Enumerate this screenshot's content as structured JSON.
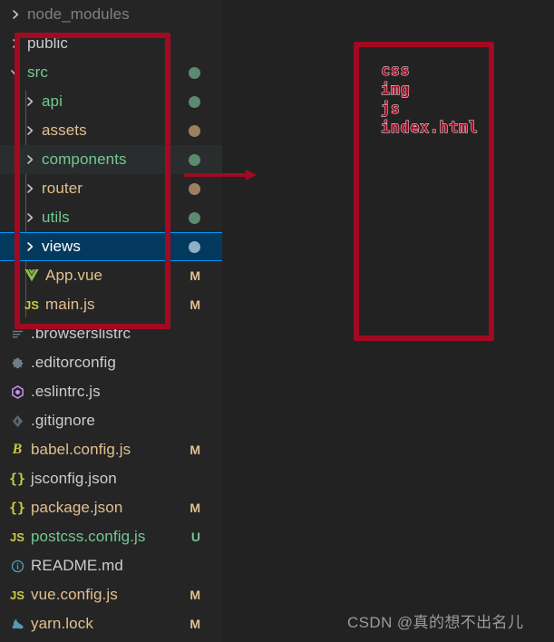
{
  "window": {
    "background": "#222222",
    "panel_background": "#252526"
  },
  "explorer": {
    "name": "vscode-file-explorer",
    "rows": [
      {
        "label": "node_modules",
        "kind": "folder",
        "expanded": false,
        "indent": 0,
        "color": "#808080",
        "badge": "",
        "dot": "",
        "state": "normal"
      },
      {
        "label": "public",
        "kind": "folder",
        "expanded": false,
        "indent": 0,
        "color": "#CCCCCC",
        "badge": "",
        "dot": "",
        "state": "normal"
      },
      {
        "label": "src",
        "kind": "folder",
        "expanded": true,
        "indent": 0,
        "color": "#73C991",
        "badge": "",
        "dot": "#5B8A6E",
        "state": "normal"
      },
      {
        "label": "api",
        "kind": "folder",
        "expanded": false,
        "indent": 1,
        "color": "#73C991",
        "badge": "",
        "dot": "#5B8A6E",
        "state": "normal"
      },
      {
        "label": "assets",
        "kind": "folder",
        "expanded": false,
        "indent": 1,
        "color": "#E2C08D",
        "badge": "",
        "dot": "#9B8060",
        "state": "normal"
      },
      {
        "label": "components",
        "kind": "folder",
        "expanded": false,
        "indent": 1,
        "color": "#73C991",
        "badge": "",
        "dot": "#5B8A6E",
        "state": "hover"
      },
      {
        "label": "router",
        "kind": "folder",
        "expanded": false,
        "indent": 1,
        "color": "#E2C08D",
        "badge": "",
        "dot": "#9B8060",
        "state": "normal"
      },
      {
        "label": "utils",
        "kind": "folder",
        "expanded": false,
        "indent": 1,
        "color": "#73C991",
        "badge": "",
        "dot": "#5B8A6E",
        "state": "normal"
      },
      {
        "label": "views",
        "kind": "folder",
        "expanded": false,
        "indent": 1,
        "color": "#FFFFFF",
        "badge": "",
        "dot": "#8FAFC7",
        "state": "selected"
      },
      {
        "label": "App.vue",
        "kind": "file",
        "icon": "vue-icon",
        "indent": 1,
        "color": "#E2C08D",
        "badge": "M",
        "badge_color": "#E2C08D",
        "dot": "",
        "state": "normal"
      },
      {
        "label": "main.js",
        "kind": "file",
        "icon": "js-icon",
        "indent": 1,
        "color": "#E2C08D",
        "badge": "M",
        "badge_color": "#E2C08D",
        "dot": "",
        "state": "normal"
      },
      {
        "label": ".browserslistrc",
        "kind": "file",
        "icon": "list-icon",
        "indent": 0,
        "color": "#CCCCCC",
        "badge": "",
        "dot": "",
        "state": "normal"
      },
      {
        "label": ".editorconfig",
        "kind": "file",
        "icon": "gear-icon",
        "indent": 0,
        "color": "#CCCCCC",
        "badge": "",
        "dot": "",
        "state": "normal"
      },
      {
        "label": ".eslintrc.js",
        "kind": "file",
        "icon": "eslint-icon",
        "indent": 0,
        "color": "#CCCCCC",
        "badge": "",
        "dot": "",
        "state": "normal"
      },
      {
        "label": ".gitignore",
        "kind": "file",
        "icon": "git-icon",
        "indent": 0,
        "color": "#CCCCCC",
        "badge": "",
        "dot": "",
        "state": "normal"
      },
      {
        "label": "babel.config.js",
        "kind": "file",
        "icon": "babel-icon",
        "indent": 0,
        "color": "#E2C08D",
        "badge": "M",
        "badge_color": "#E2C08D",
        "dot": "",
        "state": "normal"
      },
      {
        "label": "jsconfig.json",
        "kind": "file",
        "icon": "json-icon",
        "indent": 0,
        "color": "#CCCCCC",
        "badge": "",
        "dot": "",
        "state": "normal"
      },
      {
        "label": "package.json",
        "kind": "file",
        "icon": "json-icon",
        "indent": 0,
        "color": "#E2C08D",
        "badge": "M",
        "badge_color": "#E2C08D",
        "dot": "",
        "state": "normal"
      },
      {
        "label": "postcss.config.js",
        "kind": "file",
        "icon": "js-icon",
        "indent": 0,
        "color": "#73C991",
        "badge": "U",
        "badge_color": "#73C991",
        "dot": "",
        "state": "normal"
      },
      {
        "label": "README.md",
        "kind": "file",
        "icon": "info-icon",
        "indent": 0,
        "color": "#CCCCCC",
        "badge": "",
        "dot": "",
        "state": "normal"
      },
      {
        "label": "vue.config.js",
        "kind": "file",
        "icon": "js-icon",
        "indent": 0,
        "color": "#E2C08D",
        "badge": "M",
        "badge_color": "#E2C08D",
        "dot": "",
        "state": "normal"
      },
      {
        "label": "yarn.lock",
        "kind": "file",
        "icon": "yarn-icon",
        "indent": 0,
        "color": "#E2C08D",
        "badge": "M",
        "badge_color": "#E2C08D",
        "dot": "",
        "state": "normal"
      }
    ]
  },
  "annotations": {
    "color": "#A20A22",
    "left_box_label": "src-folder-highlight",
    "right_box_label": "public-contents-callout",
    "arrow_label": "points-to-callout",
    "callout_lines": [
      "css",
      "img",
      "js",
      "index.html"
    ]
  },
  "watermark": {
    "text": "CSDN @真的想不出名儿"
  }
}
